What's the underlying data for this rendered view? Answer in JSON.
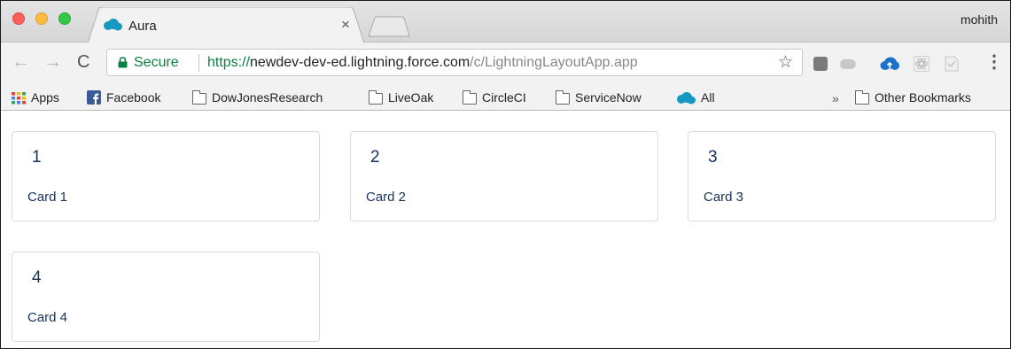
{
  "browser": {
    "tab": {
      "title": "Aura",
      "close_label": "×"
    },
    "profile_name": "mohith",
    "nav": {
      "back": "←",
      "forward": "→",
      "reload": "C"
    },
    "address": {
      "secure_label": "Secure",
      "scheme": "https://",
      "host": "newdev-dev-ed.lightning.force.com",
      "path": "/c/LightningLayoutApp.app",
      "bookmark_star": "☆"
    },
    "menu": "⋮",
    "colors": {
      "secure_green": "#0b8043",
      "salesforce_blue": "#1798c1"
    }
  },
  "bookmarks": {
    "items": [
      {
        "label": "Apps",
        "icon": "apps-grid-icon"
      },
      {
        "label": "Facebook",
        "icon": "facebook-icon"
      },
      {
        "label": "DowJonesResearch",
        "icon": "folder-icon"
      },
      {
        "label": "LiveOak",
        "icon": "folder-icon"
      },
      {
        "label": "CircleCI",
        "icon": "folder-icon"
      },
      {
        "label": "ServiceNow",
        "icon": "folder-icon"
      },
      {
        "label": "All",
        "icon": "salesforce-cloud-icon"
      }
    ],
    "overflow": "»",
    "other": {
      "label": "Other Bookmarks",
      "icon": "folder-icon"
    }
  },
  "cards": [
    {
      "title": "1",
      "body": "Card 1"
    },
    {
      "title": "2",
      "body": "Card 2"
    },
    {
      "title": "3",
      "body": "Card 3"
    },
    {
      "title": "4",
      "body": "Card 4"
    }
  ]
}
